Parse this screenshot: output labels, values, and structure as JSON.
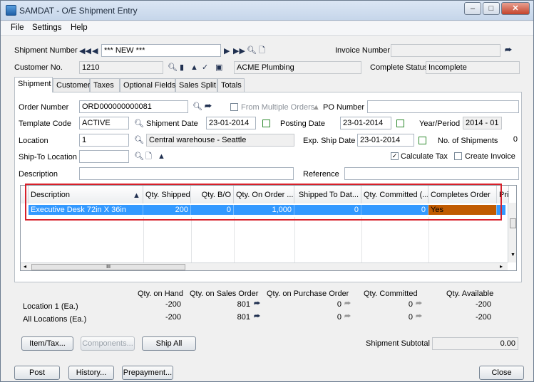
{
  "window": {
    "title": "SAMDAT - O/E Shipment Entry",
    "buttons": {
      "minimize": "–",
      "maximize": "□",
      "close": "✕"
    }
  },
  "menu": [
    "File",
    "Settings",
    "Help"
  ],
  "header": {
    "shipment_number_label": "Shipment Number",
    "shipment_number_value": "*** NEW ***",
    "invoice_number_label": "Invoice Number",
    "invoice_number_value": "",
    "customer_no_label": "Customer No.",
    "customer_no_value": "1210",
    "customer_name": "ACME Plumbing",
    "complete_status_label": "Complete Status",
    "complete_status_value": "Incomplete"
  },
  "tabs": [
    "Shipment",
    "Customer",
    "Taxes",
    "Optional Fields",
    "Sales Split",
    "Totals"
  ],
  "form": {
    "order_number_label": "Order Number",
    "order_number_value": "ORD000000000081",
    "from_multiple_orders_label": "From Multiple Orders",
    "po_number_label": "PO Number",
    "po_number_value": "",
    "template_code_label": "Template Code",
    "template_code_value": "ACTIVE",
    "shipment_date_label": "Shipment Date",
    "shipment_date_value": "23-01-2014",
    "posting_date_label": "Posting Date",
    "posting_date_value": "23-01-2014",
    "year_period_label": "Year/Period",
    "year_period_value": "2014 - 01",
    "location_label": "Location",
    "location_value": "1",
    "location_desc": "Central warehouse - Seattle",
    "exp_ship_date_label": "Exp. Ship Date",
    "exp_ship_date_value": "23-01-2014",
    "no_shipments_label": "No. of Shipments",
    "no_shipments_value": "0",
    "ship_to_label": "Ship-To Location",
    "ship_to_value": "",
    "calculate_tax_label": "Calculate Tax",
    "create_invoice_label": "Create Invoice",
    "description_label": "Description",
    "description_value": "",
    "reference_label": "Reference",
    "reference_value": ""
  },
  "grid": {
    "columns": [
      "Description",
      "Qty. Shipped",
      "Qty. B/O",
      "Qty. On Order ...",
      "Shipped To Dat...",
      "Qty. Committed (...",
      "Completes Order",
      "Pri"
    ],
    "rows": [
      [
        "Executive Desk 72in X 36in",
        "200",
        "0",
        "1,000",
        "0",
        "0",
        "Yes",
        ""
      ]
    ],
    "scroll_thumb": "III"
  },
  "totals": {
    "headers": [
      "Qty. on Hand",
      "Qty. on Sales Order",
      "Qty. on Purchase Order",
      "Qty. Committed",
      "Qty. Available"
    ],
    "rows": [
      {
        "label": "Location   1 (Ea.)",
        "values": [
          "-200",
          "801",
          "0",
          "0",
          "-200"
        ]
      },
      {
        "label": "All Locations (Ea.)",
        "values": [
          "-200",
          "801",
          "0",
          "0",
          "-200"
        ]
      }
    ]
  },
  "buttons": {
    "item_tax": "Item/Tax...",
    "components": "Components...",
    "ship_all": "Ship All",
    "post": "Post",
    "history": "History...",
    "prepayment": "Prepayment...",
    "close": "Close"
  },
  "subtotal": {
    "label": "Shipment Subtotal",
    "value": "0.00"
  },
  "colors": {
    "selection": "#3399ff",
    "completes_order": "#c05a00",
    "highlight_box": "#d8202a"
  }
}
